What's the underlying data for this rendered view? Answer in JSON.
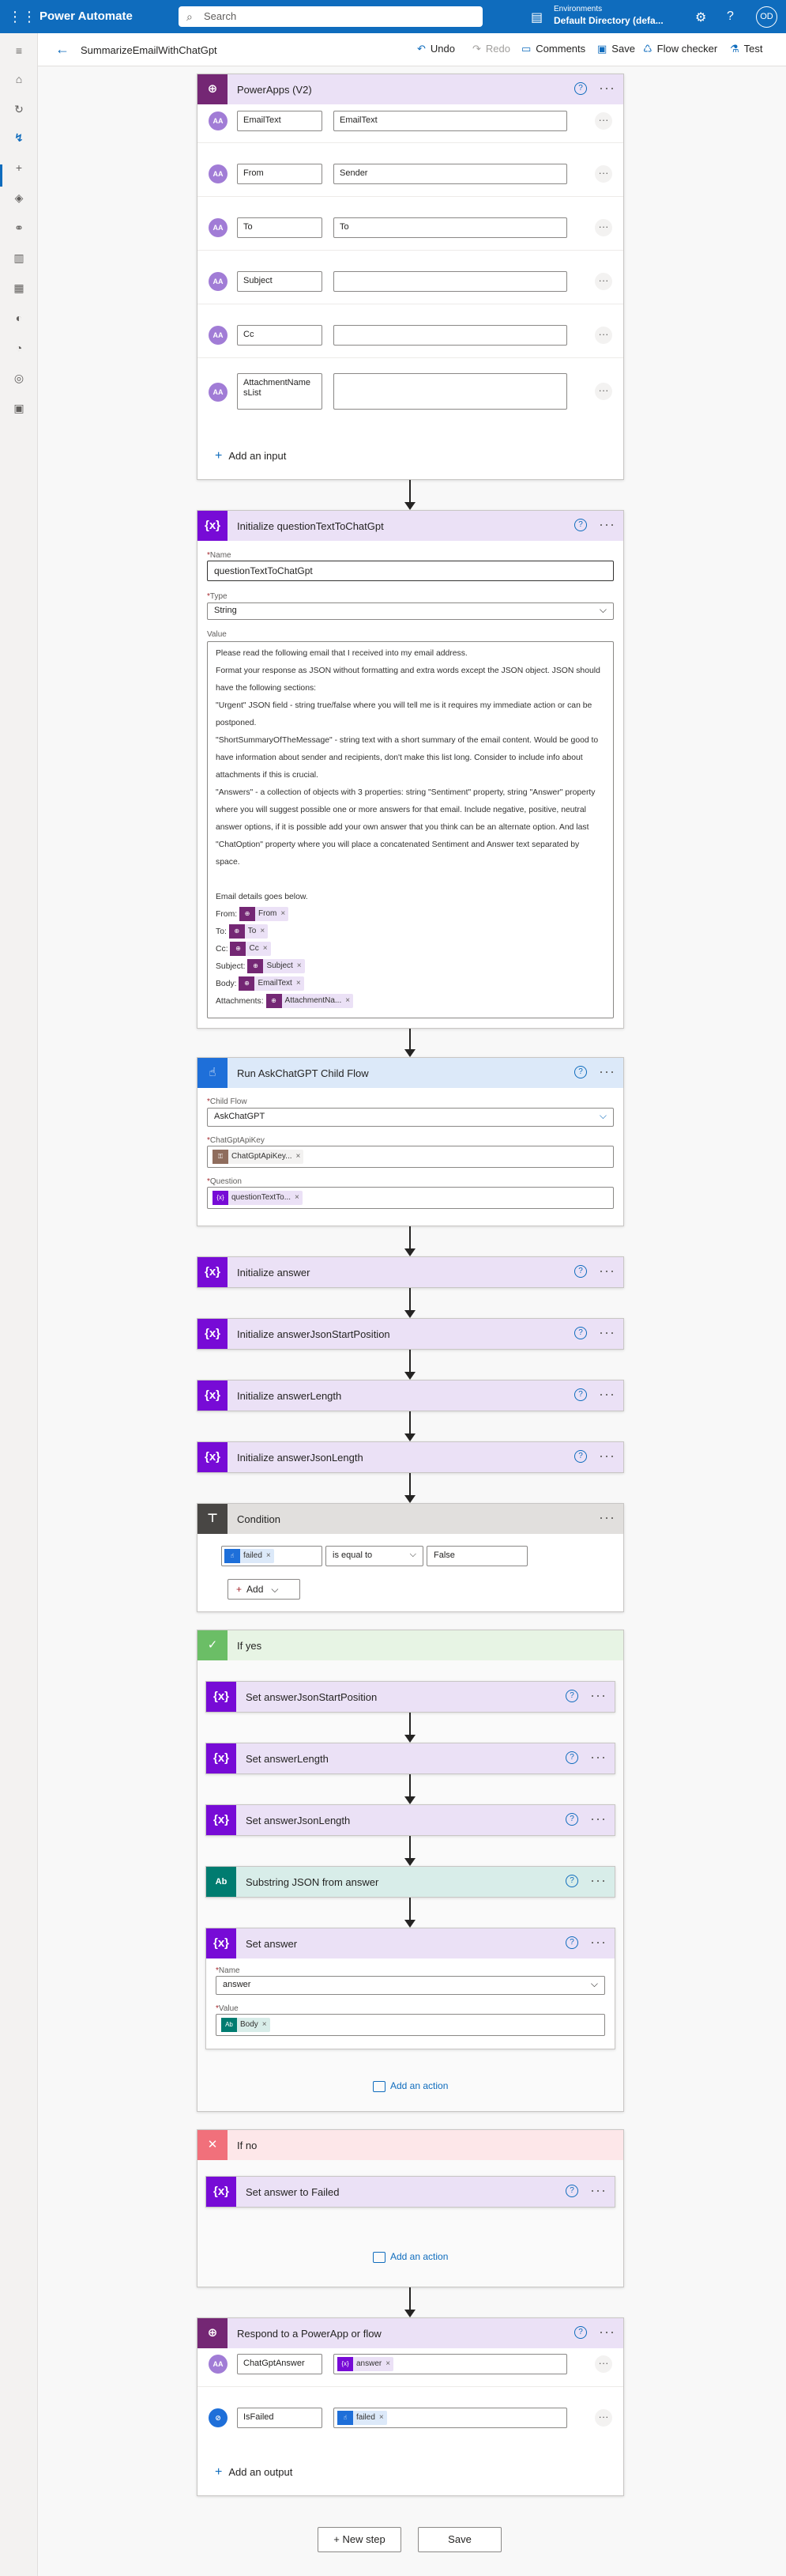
{
  "topbar": {
    "app_name": "Power Automate",
    "search_placeholder": "Search",
    "env_label": "Environments",
    "env_name": "Default Directory (defa...",
    "avatar_initials": "OD"
  },
  "cmdbar": {
    "flow_name": "SummarizeEmailWithChatGpt",
    "undo": "Undo",
    "redo": "Redo",
    "comments": "Comments",
    "save": "Save",
    "flow_checker": "Flow checker",
    "test": "Test"
  },
  "trigger": {
    "title": "PowerApps (V2)",
    "params": [
      {
        "name": "EmailText",
        "value": "EmailText"
      },
      {
        "name": "From",
        "value": "Sender"
      },
      {
        "name": "To",
        "value": "To"
      },
      {
        "name": "Subject",
        "value": ""
      },
      {
        "name": "Cc",
        "value": ""
      },
      {
        "name": "AttachmentName sList",
        "value": ""
      }
    ],
    "add_input": "Add an input"
  },
  "init_question": {
    "title": "Initialize questionTextToChatGpt",
    "name_label": "Name",
    "name_value": "questionTextToChatGpt",
    "type_label": "Type",
    "type_value": "String",
    "value_label": "Value",
    "value_lines": [
      "Please read the following email that I received into my email address.",
      "Format your response as JSON without formatting and extra words except the JSON object. JSON should have the following sections:",
      "\"Urgent\" JSON field - string true/false where you will tell me is it requires my immediate action or can be postponed.",
      "\"ShortSummaryOfTheMessage\" - string text with a short summary of the email content. Would be good to have information about sender and recipients, don't make this list long. Consider to include info about attachments if this is crucial.",
      "\"Answers\" - a collection of objects with 3 properties: string \"Sentiment\" property, string \"Answer\" property where you will suggest possible one or more answers for that email. Include negative, positive, neutral answer options, if it is possible add your own answer that you think can be an alternate option. And last \"ChatOption\" property where you will place a concatenated Sentiment and Answer text separated by space."
    ],
    "email_details": "Email details goes below.",
    "detail_rows": [
      {
        "label": "From:",
        "token": "From"
      },
      {
        "label": "To:",
        "token": "To"
      },
      {
        "label": "Cc:",
        "token": "Cc"
      },
      {
        "label": "Subject:",
        "token": "Subject"
      },
      {
        "label": "Body:",
        "token": "EmailText"
      },
      {
        "label": "Attachments:",
        "token": "AttachmentNa..."
      }
    ]
  },
  "child_flow": {
    "title": "Run AskChatGPT Child Flow",
    "child_flow_label": "Child Flow",
    "child_flow_value": "AskChatGPT",
    "apikey_label": "ChatGptApiKey",
    "apikey_token": "ChatGptApiKey...",
    "question_label": "Question",
    "question_token": "questionTextTo..."
  },
  "simple_steps": [
    "Initialize answer",
    "Initialize answerJsonStartPosition",
    "Initialize answerLength",
    "Initialize answerJsonLength"
  ],
  "condition": {
    "title": "Condition",
    "left_token": "failed",
    "operator": "is equal to",
    "right_value": "False",
    "add_label": "Add"
  },
  "if_yes": {
    "title": "If yes",
    "steps": [
      "Set answerJsonStartPosition",
      "Set answerLength",
      "Set answerJsonLength"
    ],
    "substring_title": "Substring JSON from answer",
    "set_answer_title": "Set answer",
    "name_label": "Name",
    "name_value": "answer",
    "value_label": "Value",
    "value_token": "Body",
    "add_action": "Add an action"
  },
  "if_no": {
    "title": "If no",
    "step": "Set answer to Failed",
    "add_action": "Add an action"
  },
  "respond": {
    "title": "Respond to a PowerApp or flow",
    "outputs": [
      {
        "name": "ChatGptAnswer",
        "token": "answer"
      },
      {
        "name": "IsFailed",
        "token": "failed"
      }
    ],
    "add_output": "Add an output"
  },
  "bottom": {
    "new_step": "+ New step",
    "save": "Save"
  },
  "colors": {
    "brand": "#0f6cbd",
    "variable_tile": "#770bd6",
    "powerapps_tile": "#742774",
    "condition_tile": "#484644",
    "yes_tile": "#6bbe66",
    "no_tile": "#f1707b"
  }
}
